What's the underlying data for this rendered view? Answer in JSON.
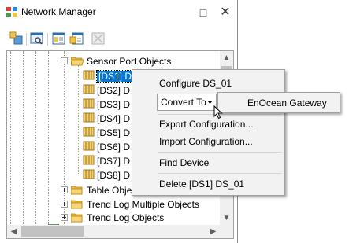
{
  "window": {
    "title": "Network Manager",
    "restore_glyph": "□",
    "close_glyph": "✕"
  },
  "toolbar": {
    "icons": [
      "add-device-icon",
      "properties-icon",
      "report-icon",
      "export-icon",
      "disabled-icon"
    ]
  },
  "tree": {
    "items": [
      {
        "label": "Sensor Port Objects",
        "expanded": true
      },
      {
        "label": "[DS1] DS_01",
        "selected": true
      },
      {
        "label": "[DS2] D"
      },
      {
        "label": "[DS3] D"
      },
      {
        "label": "[DS4] D"
      },
      {
        "label": "[DS5] D"
      },
      {
        "label": "[DS6] D"
      },
      {
        "label": "[DS7] D"
      },
      {
        "label": "[DS8] D"
      },
      {
        "label": "Table Obje"
      },
      {
        "label": "Trend Log Multiple Objects"
      },
      {
        "label": "Trend Log Objects"
      }
    ]
  },
  "context_menu": {
    "items": {
      "configure": "Configure DS_01",
      "convert_to": "Convert To",
      "export_config": "Export Configuration...",
      "import_config": "Import Configuration...",
      "find_device": "Find Device",
      "delete": "Delete [DS1] DS_01"
    },
    "submenu": {
      "enocean": "EnOcean Gateway"
    }
  },
  "colors": {
    "selection": "#0078d7",
    "menu_bg": "#f2f2f2",
    "folder": "#e8b84a"
  }
}
